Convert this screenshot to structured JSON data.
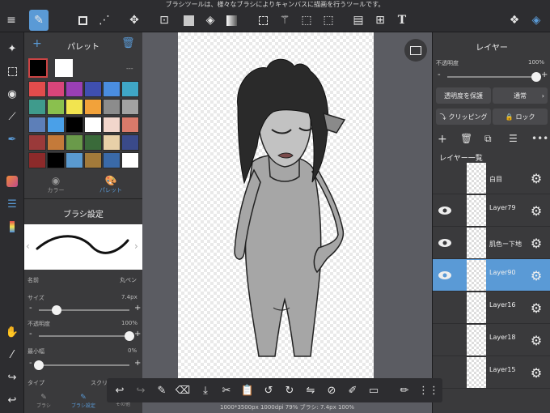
{
  "hint": "ブラシツールは、様々なブラシによりキャンバスに描画を行うツールです。",
  "palette": {
    "title": "パレット",
    "opacity_placeholder": "---",
    "colors": [
      "#e24c4c",
      "#d8457a",
      "#9a3fb4",
      "#3f4fb0",
      "#4a8de0",
      "#3fa7c6",
      "#3f9b8c",
      "#8ac04e",
      "#f2e44f",
      "#f2a23a",
      "#8c8c8c",
      "#a2a2a2",
      "#5d7fb8",
      "#4aa0e8",
      "#000000",
      "#ffffff",
      "#f2d6cc",
      "#d97a6a",
      "#9a3a3a",
      "#c47a3a",
      "#6a9a4a",
      "#3a6a3a",
      "#e8d0a8",
      "#3a4a8a",
      "#8c2a2a",
      "#000000",
      "#5a9ad0",
      "#a27a3a",
      "#3a6aa8",
      "#ffffff"
    ],
    "tab_color": "カラー",
    "tab_palette": "パレット"
  },
  "brush": {
    "title": "ブラシ設定",
    "name_label": "名前",
    "name_value": "丸ペン",
    "size_label": "サイズ",
    "size_value": "7.4px",
    "size_level": 0.2,
    "opacity_label": "不透明度",
    "opacity_value": "100%",
    "opacity_level": 1.0,
    "minwidth_label": "最小幅",
    "minwidth_value": "0%",
    "minwidth_level": 0.0,
    "type_label": "タイプ",
    "type_value": "スクリ",
    "tab_brush": "ブラシ",
    "tab_settings": "ブラシ設定",
    "tab_other": "その他",
    "minus": "-",
    "plus": "+"
  },
  "layers": {
    "title": "レイヤー",
    "opacity_label": "不透明度",
    "opacity_value": "100%",
    "opacity_level": 1.0,
    "protect_label": "透明度を保護",
    "blend_label": "通常",
    "clipping_label": "クリッピング",
    "lock_label": "ロック",
    "list_title": "レイヤー一覧",
    "minus": "-",
    "plus": "+",
    "items": [
      {
        "name": "白目",
        "visible": false,
        "selected": false
      },
      {
        "name": "Layer79",
        "visible": true,
        "selected": false
      },
      {
        "name": "肌色ー下地",
        "visible": true,
        "selected": false
      },
      {
        "name": "Layer90",
        "visible": true,
        "selected": true
      },
      {
        "name": "Layer16",
        "visible": false,
        "selected": false
      },
      {
        "name": "Layer18",
        "visible": false,
        "selected": false
      },
      {
        "name": "Layer15",
        "visible": false,
        "selected": false
      }
    ]
  },
  "status": "1000*3500px 1000dpi 79% ブラシ: 7.4px 100%",
  "text_tool_glyph": "T",
  "icons": [
    "menu-icon",
    "brush-icon",
    "rect-icon",
    "dots-icon",
    "move-icon",
    "fill-color-icon",
    "bucket-icon",
    "gradient-icon",
    "select-rect-icon",
    "wand-icon",
    "select-pen-icon",
    "select-eraser-icon",
    "panel-icon",
    "cut-icon",
    "text-icon",
    "materials-icon",
    "layers-icon"
  ]
}
